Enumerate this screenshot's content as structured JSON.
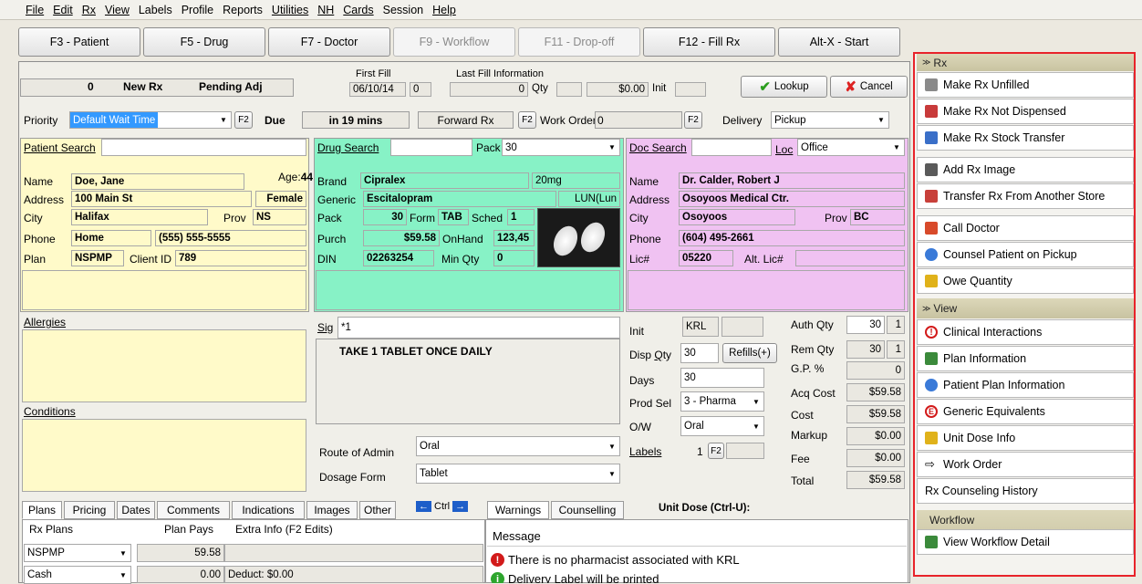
{
  "menu": [
    "File",
    "Edit",
    "Rx",
    "View",
    "Labels",
    "Profile",
    "Reports",
    "Utilities",
    "NH",
    "Cards",
    "Session",
    "Help"
  ],
  "toolbar": [
    {
      "label": "F3 - Patient",
      "disabled": false
    },
    {
      "label": "F5 - Drug",
      "disabled": false
    },
    {
      "label": "F7 - Doctor",
      "disabled": false
    },
    {
      "label": "F9 - Workflow",
      "disabled": true
    },
    {
      "label": "F11 - Drop-off",
      "disabled": true
    },
    {
      "label": "F12 - Fill Rx",
      "disabled": false
    },
    {
      "label": "Alt-X - Start",
      "disabled": false
    }
  ],
  "status": {
    "num": "0",
    "new_rx": "New Rx",
    "pending": "Pending Adj",
    "first_fill_label": "First Fill",
    "first_fill_date": "06/10/14",
    "first_fill_qty": "0",
    "last_fill_label": "Last Fill Information",
    "last_qty": "0",
    "qty_label": "Qty",
    "last_price": "$0.00",
    "init_label": "Init",
    "lookup": "Lookup",
    "cancel": "Cancel"
  },
  "priority": {
    "label": "Priority",
    "value": "Default Wait Time",
    "f2": "F2",
    "due_label": "Due",
    "due_value": "in 19 mins",
    "forward": "Forward Rx",
    "work_order_label": "Work Order",
    "work_order_value": "0",
    "delivery_label": "Delivery",
    "delivery_value": "Pickup"
  },
  "patient": {
    "search_label": "Patient Search",
    "name_label": "Name",
    "name": "Doe, Jane",
    "age_label": "Age:",
    "age": "44",
    "address_label": "Address",
    "address": "100 Main St",
    "gender": "Female",
    "city_label": "City",
    "city": "Halifax",
    "prov_label": "Prov",
    "prov": "NS",
    "phone_label": "Phone",
    "phone_type": "Home",
    "phone": "(555) 555-5555",
    "plan_label": "Plan",
    "plan": "NSPMP",
    "client_id_label": "Client ID",
    "client_id": "789",
    "allergies": "Allergies",
    "conditions": "Conditions"
  },
  "drug": {
    "search_label": "Drug Search",
    "pack_label": "Pack",
    "pack": "30",
    "brand_label": "Brand",
    "brand": "Cipralex",
    "strength": "20mg",
    "generic_label": "Generic",
    "generic": "Escitalopram",
    "mfr": "LUN(Lun",
    "pack2_label": "Pack",
    "pack2": "30",
    "form_label": "Form",
    "form": "TAB",
    "sched_label": "Sched",
    "sched": "1",
    "purch_label": "Purch",
    "purch": "$59.58",
    "onhand_label": "OnHand",
    "onhand": "123,45",
    "din_label": "DIN",
    "din": "02263254",
    "minqty_label": "Min Qty",
    "minqty": "0"
  },
  "doctor": {
    "search_label": "Doc Search",
    "loc_label": "Loc",
    "loc": "Office",
    "name_label": "Name",
    "name": "Dr. Calder, Robert J",
    "address_label": "Address",
    "address": "Osoyoos Medical Ctr.",
    "city_label": "City",
    "city": "Osoyoos",
    "prov_label": "Prov",
    "prov": "BC",
    "phone_label": "Phone",
    "phone": "(604) 495-2661",
    "lic_label": "Lic#",
    "lic": "05220",
    "alt_lic_label": "Alt. Lic#"
  },
  "sig": {
    "label": "Sig",
    "code": "*1",
    "text": "TAKE 1 TABLET ONCE DAILY",
    "route_label": "Route of Admin",
    "route": "Oral",
    "dosage_label": "Dosage Form",
    "dosage": "Tablet"
  },
  "fill": {
    "init_label": "Init",
    "init": "KRL",
    "disp_label": "Disp Qty",
    "disp": "30",
    "refills": "Refills(+)",
    "days_label": "Days",
    "days": "30",
    "prodsel_label": "Prod Sel",
    "prodsel": "3 - Pharma",
    "ow_label": "O/W",
    "ow": "Oral",
    "labels_label": "Labels",
    "labels": "1",
    "f2": "F2"
  },
  "pricing": {
    "auth_label": "Auth Qty",
    "auth": "30",
    "auth2": "1",
    "rem_label": "Rem Qty",
    "rem": "30",
    "rem2": "1",
    "gp_label": "G.P. %",
    "gp": "0",
    "acq_label": "Acq Cost",
    "acq": "$59.58",
    "cost_label": "Cost",
    "cost": "$59.58",
    "markup_label": "Markup",
    "markup": "$0.00",
    "fee_label": "Fee",
    "fee": "$0.00",
    "total_label": "Total",
    "total": "$59.58"
  },
  "tabs": [
    "Plans",
    "Pricing",
    "Dates",
    "Comments",
    "Indications",
    "Images",
    "Other"
  ],
  "ctrl": "Ctrl",
  "plans": {
    "col1": "Rx Plans",
    "col2": "Plan Pays",
    "col3": "Extra Info (F2 Edits)",
    "rows": [
      {
        "plan": "NSPMP",
        "pays": "59.58",
        "extra": ""
      },
      {
        "plan": "Cash",
        "pays": "0.00",
        "extra": "Deduct: $0.00"
      }
    ]
  },
  "warn_tabs": [
    "Warnings",
    "Counselling"
  ],
  "unit_dose": "Unit Dose (Ctrl-U):",
  "messages": {
    "header": "Message",
    "items": [
      "There is no pharmacist associated with KRL",
      "Delivery Label will be printed"
    ]
  },
  "rxpanel": {
    "rx_header": "Rx",
    "rx_items": [
      "Make Rx Unfilled",
      "Make Rx Not Dispensed",
      "Make Rx Stock Transfer",
      "Add Rx Image",
      "Transfer Rx From Another Store",
      "Call Doctor",
      "Counsel Patient on Pickup",
      "Owe Quantity"
    ],
    "view_header": "View",
    "view_items": [
      "Clinical Interactions",
      "Plan Information",
      "Patient Plan Information",
      "Generic Equivalents",
      "Unit Dose Info",
      "Work Order",
      "Rx Counseling History"
    ],
    "workflow_header": "Workflow",
    "workflow_items": [
      "View Workflow Detail"
    ]
  }
}
